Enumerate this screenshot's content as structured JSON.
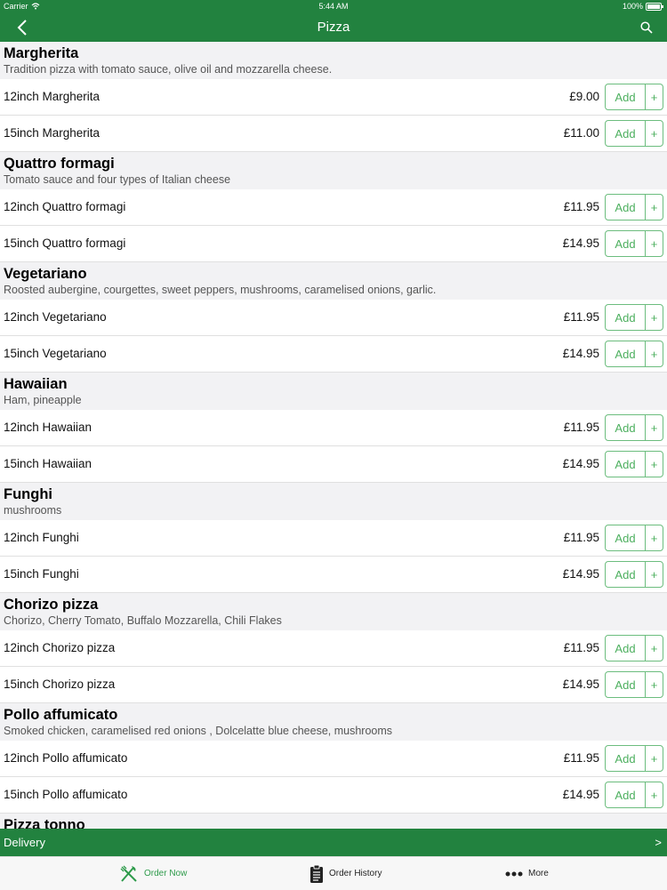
{
  "status_bar": {
    "carrier": "Carrier",
    "time": "5:44 AM",
    "battery": "100%"
  },
  "nav": {
    "title": "Pizza"
  },
  "colors": {
    "brand_green": "#22823f",
    "accent_green": "#4caf5e"
  },
  "add_label": "Add",
  "plus_label": "+",
  "sections": [
    {
      "name": "Margherita",
      "description": "Tradition pizza with tomato sauce, olive oil and mozzarella cheese.",
      "items": [
        {
          "name": "12inch Margherita",
          "price": "£9.00"
        },
        {
          "name": "15inch Margherita",
          "price": "£11.00"
        }
      ]
    },
    {
      "name": "Quattro formagi",
      "description": "Tomato sauce and four types of Italian cheese",
      "items": [
        {
          "name": "12inch Quattro formagi",
          "price": "£11.95"
        },
        {
          "name": "15inch Quattro formagi",
          "price": "£14.95"
        }
      ]
    },
    {
      "name": "Vegetariano",
      "description": "Roosted aubergine, courgettes, sweet peppers, mushrooms, caramelised onions, garlic.",
      "items": [
        {
          "name": "12inch Vegetariano",
          "price": "£11.95"
        },
        {
          "name": "15inch Vegetariano",
          "price": "£14.95"
        }
      ]
    },
    {
      "name": "Hawaiian",
      "description": "Ham, pineapple",
      "items": [
        {
          "name": "12inch Hawaiian",
          "price": "£11.95"
        },
        {
          "name": "15inch Hawaiian",
          "price": "£14.95"
        }
      ]
    },
    {
      "name": "Funghi",
      "description": "mushrooms",
      "items": [
        {
          "name": "12inch Funghi",
          "price": "£11.95"
        },
        {
          "name": "15inch Funghi",
          "price": "£14.95"
        }
      ]
    },
    {
      "name": "Chorizo pizza",
      "description": "Chorizo, Cherry Tomato, Buffalo Mozzarella, Chili Flakes",
      "items": [
        {
          "name": "12inch Chorizo pizza",
          "price": "£11.95"
        },
        {
          "name": "15inch Chorizo pizza",
          "price": "£14.95"
        }
      ]
    },
    {
      "name": "Pollo affumicato",
      "description": "Smoked chicken, caramelised red onions , Dolcelatte blue cheese, mushrooms",
      "items": [
        {
          "name": "12inch Pollo affumicato",
          "price": "£11.95"
        },
        {
          "name": "15inch Pollo affumicato",
          "price": "£14.95"
        }
      ]
    },
    {
      "name": "Pizza tonno",
      "description": "",
      "items": []
    }
  ],
  "delivery": {
    "label": "Delivery",
    "arrow": ">"
  },
  "tabs": [
    {
      "label": "Order Now",
      "icon": "fork-knife-icon",
      "active": true
    },
    {
      "label": "Order History",
      "icon": "clipboard-icon",
      "active": false
    },
    {
      "label": "More",
      "icon": "more-dots-icon",
      "active": false
    }
  ]
}
